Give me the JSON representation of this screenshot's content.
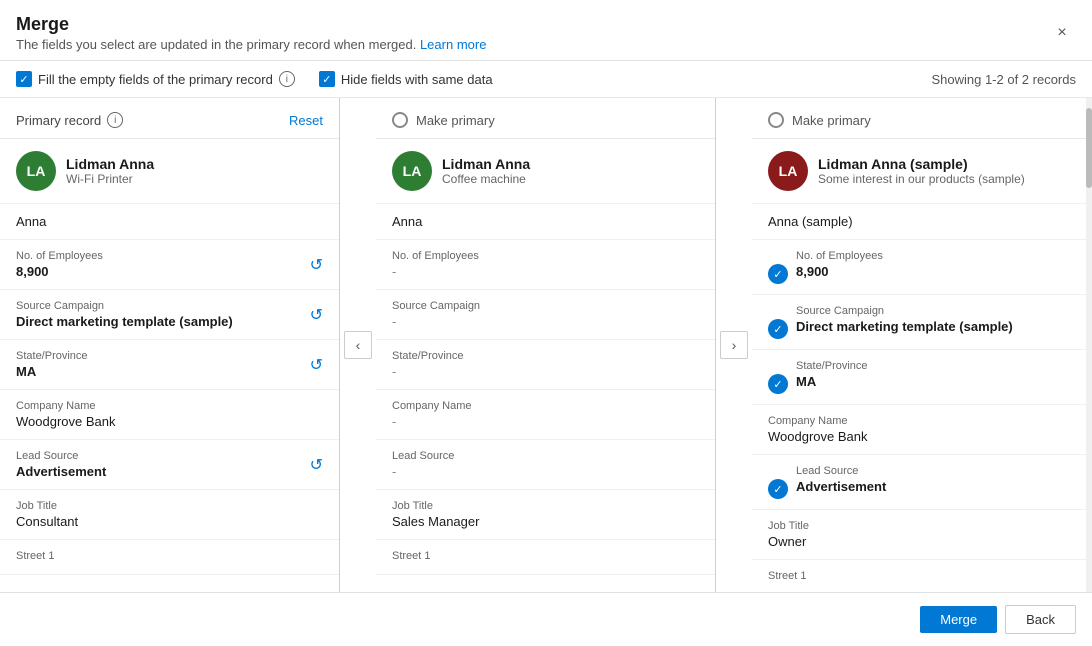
{
  "dialog": {
    "title": "Merge",
    "subtitle": "The fields you select are updated in the primary record when merged.",
    "learn_more": "Learn more",
    "close_label": "×"
  },
  "options": {
    "fill_empty_label": "Fill the empty fields of the primary record",
    "hide_same_label": "Hide fields with same data",
    "records_count": "Showing 1-2 of 2 records"
  },
  "column1": {
    "header_label": "Primary record",
    "reset_label": "Reset",
    "avatar_initials": "LA",
    "record_name": "Lidman Anna",
    "record_sub": "Wi-Fi Printer",
    "first_name": "Anna",
    "employees_label": "No. of Employees",
    "employees_value": "8,900",
    "source_campaign_label": "Source Campaign",
    "source_campaign_value": "Direct marketing template (sample)",
    "state_label": "State/Province",
    "state_value": "MA",
    "company_label": "Company Name",
    "company_value": "Woodgrove Bank",
    "lead_source_label": "Lead Source",
    "lead_source_value": "Advertisement",
    "job_title_label": "Job Title",
    "job_title_value": "Consultant",
    "street_label": "Street 1"
  },
  "column2": {
    "header_label": "Make primary",
    "avatar_initials": "LA",
    "record_name": "Lidman Anna",
    "record_sub": "Coffee machine",
    "first_name": "Anna",
    "employees_label": "No. of Employees",
    "employees_value": "-",
    "source_campaign_label": "Source Campaign",
    "source_campaign_value": "-",
    "state_label": "State/Province",
    "state_value": "-",
    "company_label": "Company Name",
    "company_value": "-",
    "lead_source_label": "Lead Source",
    "lead_source_value": "-",
    "job_title_label": "Job Title",
    "job_title_value": "Sales Manager",
    "street_label": "Street 1"
  },
  "column3": {
    "header_label": "Make primary",
    "avatar_initials": "LA",
    "record_name": "Lidman Anna (sample)",
    "record_sub": "Some interest in our products (sample)",
    "first_name": "Anna (sample)",
    "employees_label": "No. of Employees",
    "employees_value": "8,900",
    "source_campaign_label": "Source Campaign",
    "source_campaign_value": "Direct marketing template (sample)",
    "state_label": "State/Province",
    "state_value": "MA",
    "company_label": "Company Name",
    "company_value": "Woodgrove Bank",
    "lead_source_label": "Lead Source",
    "lead_source_value": "Advertisement",
    "job_title_label": "Job Title",
    "job_title_value": "Owner",
    "street_label": "Street 1"
  },
  "footer": {
    "merge_label": "Merge",
    "back_label": "Back"
  },
  "nav": {
    "prev": "‹",
    "next": "›"
  }
}
